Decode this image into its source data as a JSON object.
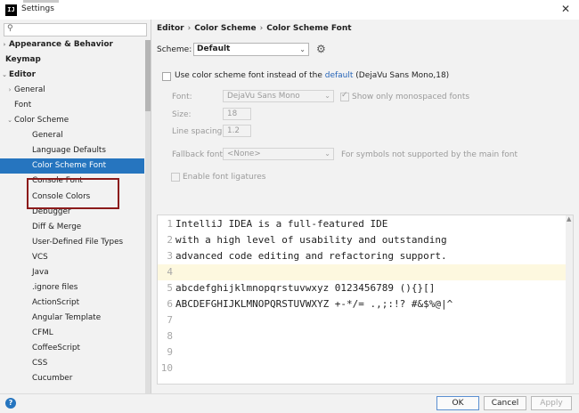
{
  "window": {
    "title": "Settings",
    "app_icon_text": "IJ"
  },
  "search": {
    "value": ""
  },
  "sidebar": {
    "items": [
      {
        "label": "Appearance & Behavior",
        "arrow": "›",
        "level": 0,
        "bold": true
      },
      {
        "label": "Keymap",
        "arrow": "",
        "level": 0,
        "bold": true
      },
      {
        "label": "Editor",
        "arrow": "⌄",
        "level": 0,
        "bold": true
      },
      {
        "label": "General",
        "arrow": "›",
        "level": 1,
        "bold": false
      },
      {
        "label": "Font",
        "arrow": "",
        "level": 1,
        "bold": false
      },
      {
        "label": "Color Scheme",
        "arrow": "⌄",
        "level": 1,
        "bold": false
      },
      {
        "label": "General",
        "arrow": "",
        "level": 2,
        "bold": false
      },
      {
        "label": "Language Defaults",
        "arrow": "",
        "level": 2,
        "bold": false
      },
      {
        "label": "Color Scheme Font",
        "arrow": "",
        "level": 2,
        "bold": false,
        "selected": true
      },
      {
        "label": "Console Font",
        "arrow": "",
        "level": 2,
        "bold": false
      },
      {
        "label": "Console Colors",
        "arrow": "",
        "level": 2,
        "bold": false
      },
      {
        "label": "Debugger",
        "arrow": "",
        "level": 2,
        "bold": false
      },
      {
        "label": "Diff & Merge",
        "arrow": "",
        "level": 2,
        "bold": false
      },
      {
        "label": "User-Defined File Types",
        "arrow": "",
        "level": 2,
        "bold": false
      },
      {
        "label": "VCS",
        "arrow": "",
        "level": 2,
        "bold": false
      },
      {
        "label": "Java",
        "arrow": "",
        "level": 2,
        "bold": false
      },
      {
        "label": ".ignore files",
        "arrow": "",
        "level": 2,
        "bold": false
      },
      {
        "label": "ActionScript",
        "arrow": "",
        "level": 2,
        "bold": false
      },
      {
        "label": "Angular Template",
        "arrow": "",
        "level": 2,
        "bold": false
      },
      {
        "label": "CFML",
        "arrow": "",
        "level": 2,
        "bold": false
      },
      {
        "label": "CoffeeScript",
        "arrow": "",
        "level": 2,
        "bold": false
      },
      {
        "label": "CSS",
        "arrow": "",
        "level": 2,
        "bold": false
      },
      {
        "label": "Cucumber",
        "arrow": "",
        "level": 2,
        "bold": false
      }
    ]
  },
  "breadcrumb": [
    "Editor",
    "Color Scheme",
    "Color Scheme Font"
  ],
  "scheme": {
    "label": "Scheme:",
    "value": "Default"
  },
  "options": {
    "use_scheme_font_label": "Use color scheme font instead of the",
    "default_link": "default",
    "default_font_info": "(DejaVu Sans Mono,18)",
    "font_label": "Font:",
    "font_value": "DejaVu Sans Mono",
    "monospaced_label": "Show only monospaced fonts",
    "size_label": "Size:",
    "size_value": "18",
    "line_spacing_label": "Line spacing:",
    "line_spacing_value": "1.2",
    "fallback_label": "Fallback font:",
    "fallback_value": "<None>",
    "fallback_hint": "For symbols not supported by the main font",
    "ligatures_label": "Enable font ligatures"
  },
  "preview": {
    "current_line": 4,
    "lines": [
      {
        "num": "1",
        "text": "IntelliJ IDEA is a full-featured IDE"
      },
      {
        "num": "2",
        "text": "with a high level of usability and outstanding"
      },
      {
        "num": "3",
        "text": "advanced code editing and refactoring support."
      },
      {
        "num": "4",
        "text": ""
      },
      {
        "num": "5",
        "text": "abcdefghijklmnopqrstuvwxyz 0123456789 (){}[]"
      },
      {
        "num": "6",
        "text": "ABCDEFGHIJKLMNOPQRSTUVWXYZ +-*/= .,;:!? #&$%@|^"
      },
      {
        "num": "7",
        "text": ""
      },
      {
        "num": "8",
        "text": ""
      },
      {
        "num": "9",
        "text": ""
      },
      {
        "num": "10",
        "text": ""
      }
    ]
  },
  "footer": {
    "help": "?",
    "ok": "OK",
    "cancel": "Cancel",
    "apply": "Apply"
  }
}
